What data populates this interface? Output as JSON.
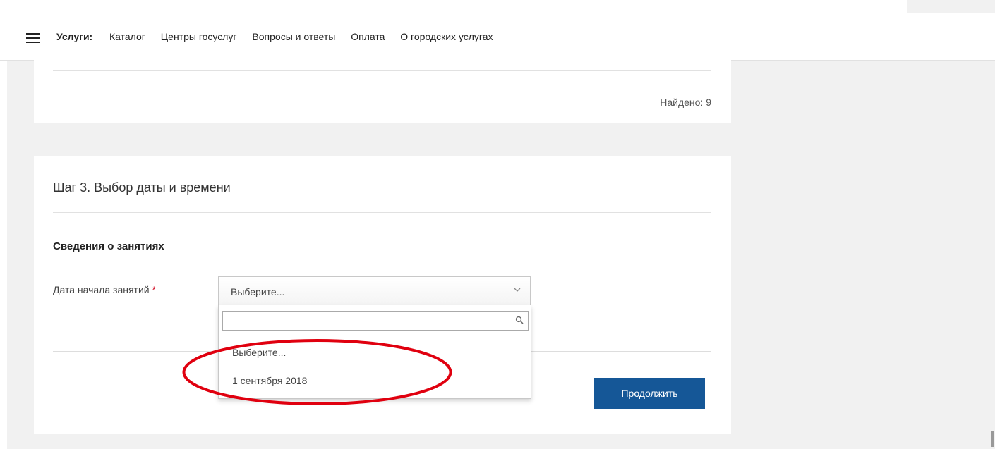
{
  "nav": {
    "title": "Услуги:",
    "links": [
      "Каталог",
      "Центры госуслуг",
      "Вопросы и ответы",
      "Оплата",
      "О городских услугах"
    ]
  },
  "results": {
    "found_text": "Найдено: 9"
  },
  "step": {
    "title": "Шаг 3. Выбор даты и времени",
    "section_title": "Сведения о занятиях",
    "field_label": "Дата начала занятий",
    "required_mark": "*",
    "select": {
      "value": "Выберите...",
      "search_value": "",
      "options": [
        "Выберите...",
        "1 сентября 2018"
      ]
    },
    "continue_label": "Продолжить"
  },
  "colors": {
    "accent": "#155797",
    "required": "#d0021b",
    "annotation": "#e0000f",
    "page_bg": "#f1f1f1"
  },
  "icons": [
    "menu-icon",
    "chevron-down-icon",
    "search-icon"
  ]
}
